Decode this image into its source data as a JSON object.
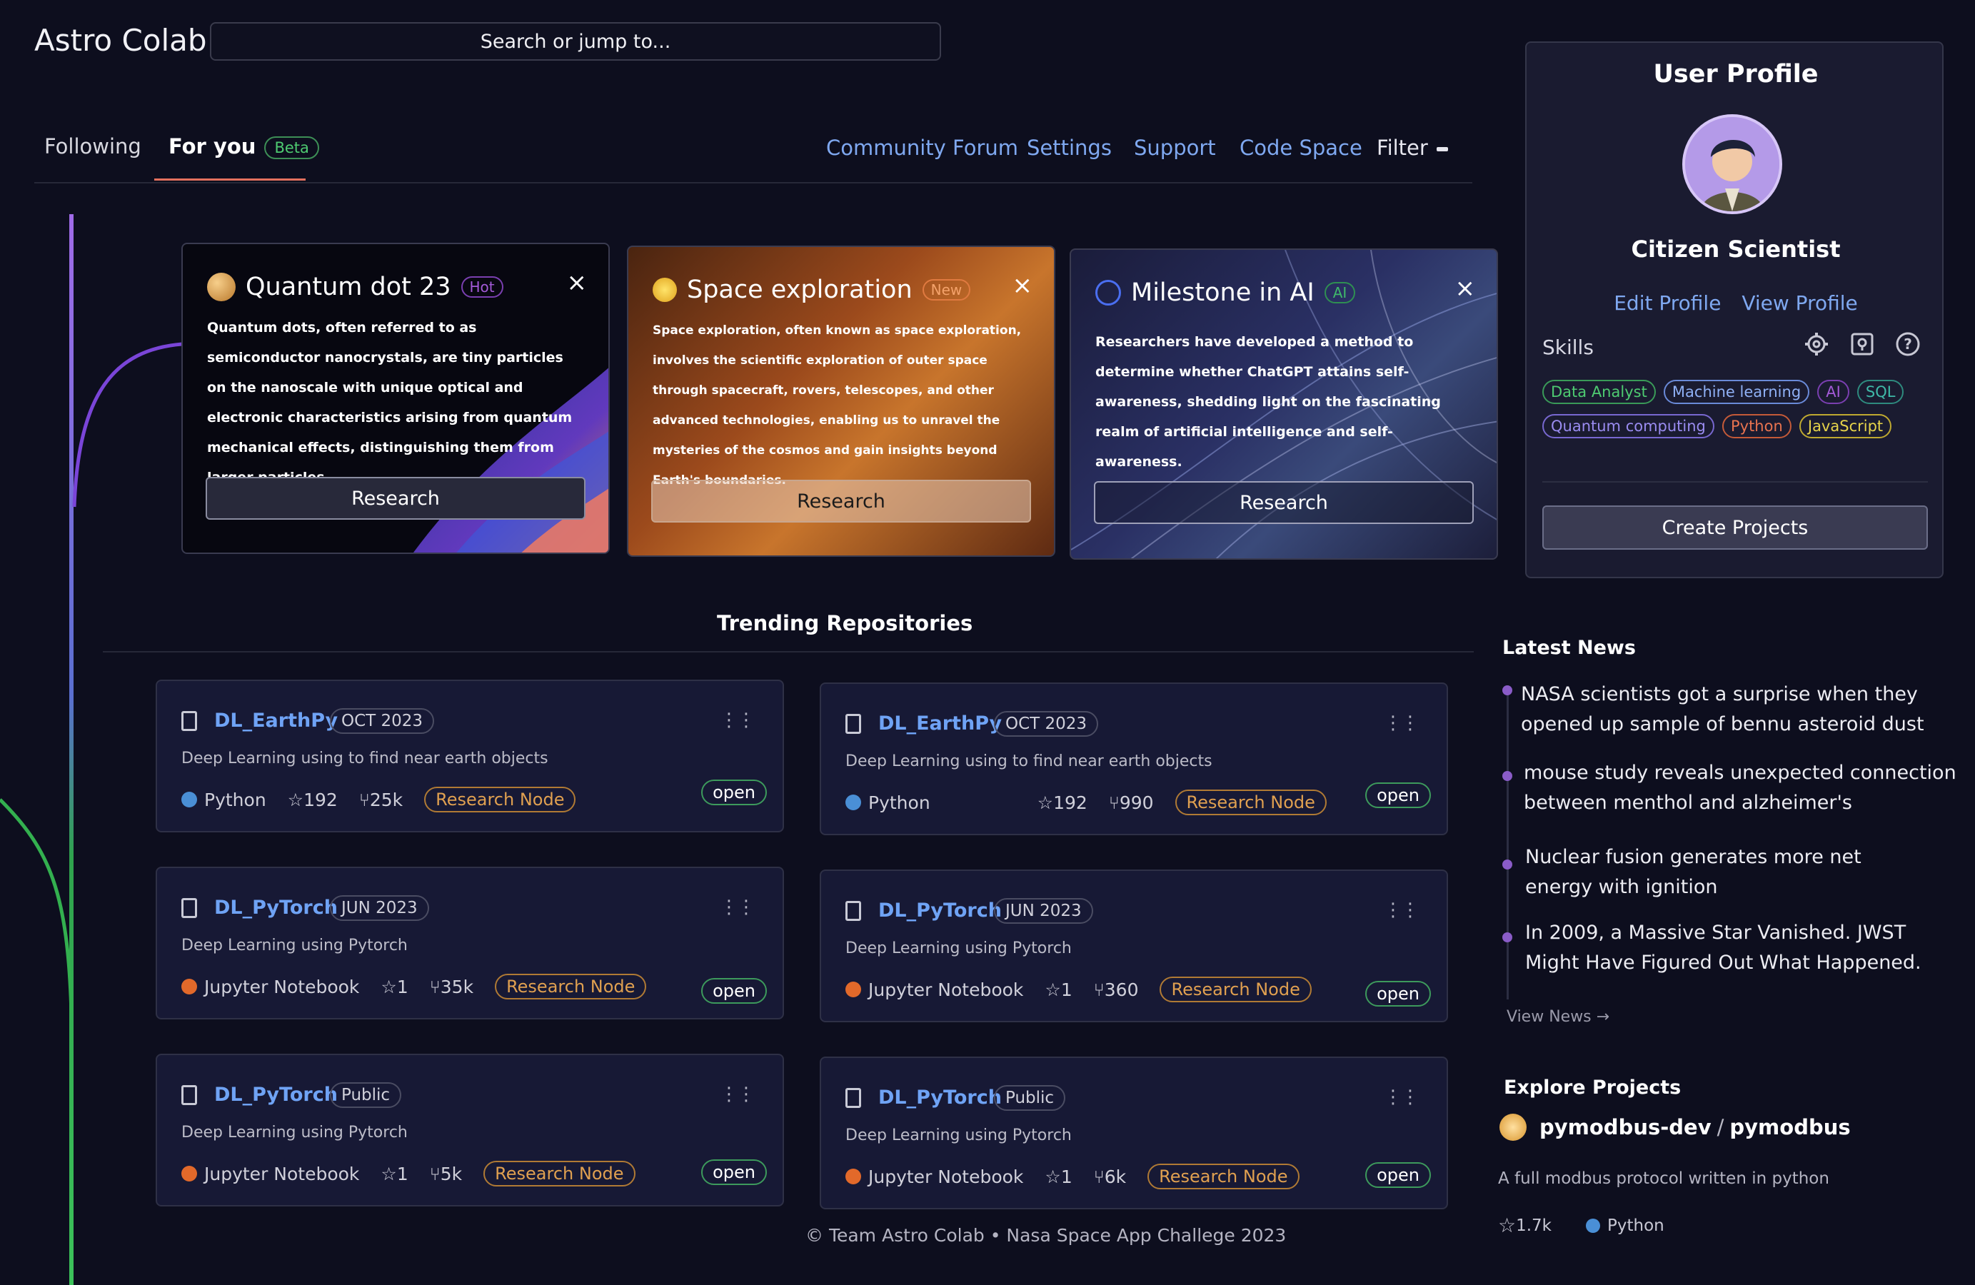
{
  "app": {
    "title": "Astro Colab"
  },
  "search": {
    "placeholder": "Search or jump to..."
  },
  "tabs": [
    {
      "label": "Following"
    },
    {
      "label": "For you",
      "badge": "Beta"
    }
  ],
  "nav": {
    "links": [
      "Community Forum",
      "Settings",
      "Support",
      "Code Space"
    ],
    "filter": "Filter"
  },
  "feature_cards": [
    {
      "title": "Quantum dot 23",
      "badge": "Hot",
      "body": "Quantum dots, often referred to as semiconductor nanocrystals, are tiny particles on the nanoscale with unique optical and electronic characteristics arising from quantum mechanical effects, distinguishing them from larger particles.",
      "button": "Research",
      "close": "×"
    },
    {
      "title": "Space exploration",
      "badge": "New",
      "body": "Space exploration, often known as space exploration, involves the scientific exploration of outer space through spacecraft, rovers, telescopes, and other advanced technologies, enabling us to unravel the mysteries of the cosmos and gain insights beyond Earth's boundaries.",
      "button": "Research",
      "close": "×"
    },
    {
      "title": "Milestone in AI",
      "badge": "AI",
      "body": "Researchers have developed a method to determine whether ChatGPT attains self-awareness, shedding light on the fascinating realm of artificial intelligence and self-awareness.",
      "button": "Research",
      "close": "×"
    }
  ],
  "trending": {
    "title": "Trending Repositories",
    "repos": [
      {
        "name": "DL_EarthPy",
        "date": "OCT 2023",
        "desc": "Deep Learning using to find near earth objects",
        "lang": "Python",
        "lang_color": "#4a8fd6",
        "stars": "192",
        "forks": "25k",
        "tag": "Research Node",
        "status": "open"
      },
      {
        "name": "DL_EarthPy",
        "date": "OCT 2023",
        "desc": "Deep Learning using to find near earth objects",
        "lang": "Python",
        "lang_color": "#4a8fd6",
        "stars": "192",
        "forks": "990",
        "tag": "Research Node",
        "status": "open"
      },
      {
        "name": "DL_PyTorch",
        "date": "JUN 2023",
        "desc": "Deep Learning using Pytorch",
        "lang": "Jupyter Notebook",
        "lang_color": "#e2692a",
        "stars": "1",
        "forks": "35k",
        "tag": "Research Node",
        "status": "open"
      },
      {
        "name": "DL_PyTorch",
        "date": "JUN 2023",
        "desc": "Deep Learning using Pytorch",
        "lang": "Jupyter Notebook",
        "lang_color": "#e2692a",
        "stars": "1",
        "forks": "360",
        "tag": "Research Node",
        "status": "open"
      },
      {
        "name": "DL_PyTorch",
        "date": "Public",
        "desc": "Deep Learning using Pytorch",
        "lang": "Jupyter Notebook",
        "lang_color": "#e2692a",
        "stars": "1",
        "forks": "5k",
        "tag": "Research Node",
        "status": "open"
      },
      {
        "name": "DL_PyTorch",
        "date": "Public",
        "desc": "Deep Learning using Pytorch",
        "lang": "Jupyter Notebook",
        "lang_color": "#e2692a",
        "stars": "1",
        "forks": "6k",
        "tag": "Research Node",
        "status": "open"
      }
    ]
  },
  "footer": "© Team Astro Colab • Nasa Space App Challege 2023",
  "profile": {
    "title": "User Profile",
    "name": "Citizen Scientist",
    "edit": "Edit Profile",
    "view": "View Profile",
    "skills_label": "Skills",
    "skills": [
      {
        "label": "Data Analyst",
        "color": "#4ecb71"
      },
      {
        "label": "Machine learning",
        "color": "#8fb0f5"
      },
      {
        "label": "AI",
        "color": "#a35ad8"
      },
      {
        "label": "SQL",
        "color": "#3fb9a8"
      },
      {
        "label": "Quantum computing",
        "color": "#9a8cf0"
      },
      {
        "label": "Python",
        "color": "#e8734f"
      },
      {
        "label": "JavaScript",
        "color": "#e6d34a"
      }
    ],
    "create": "Create Projects"
  },
  "news": {
    "title": "Latest News",
    "items": [
      "NASA scientists got a surprise when they opened up sample of bennu asteroid dust",
      "mouse study reveals unexpected connection between menthol and alzheimer's",
      "Nuclear fusion generates more net energy with ignition",
      "In 2009, a Massive Star Vanished. JWST Might Have Figured Out What Happened."
    ],
    "view": "View News →"
  },
  "explore": {
    "title": "Explore Projects",
    "owner": "pymodbus-dev",
    "sep": "/",
    "repo": "pymodbus",
    "desc": "A full modbus protocol written in python",
    "stars": "1.7k",
    "lang": "Python"
  }
}
